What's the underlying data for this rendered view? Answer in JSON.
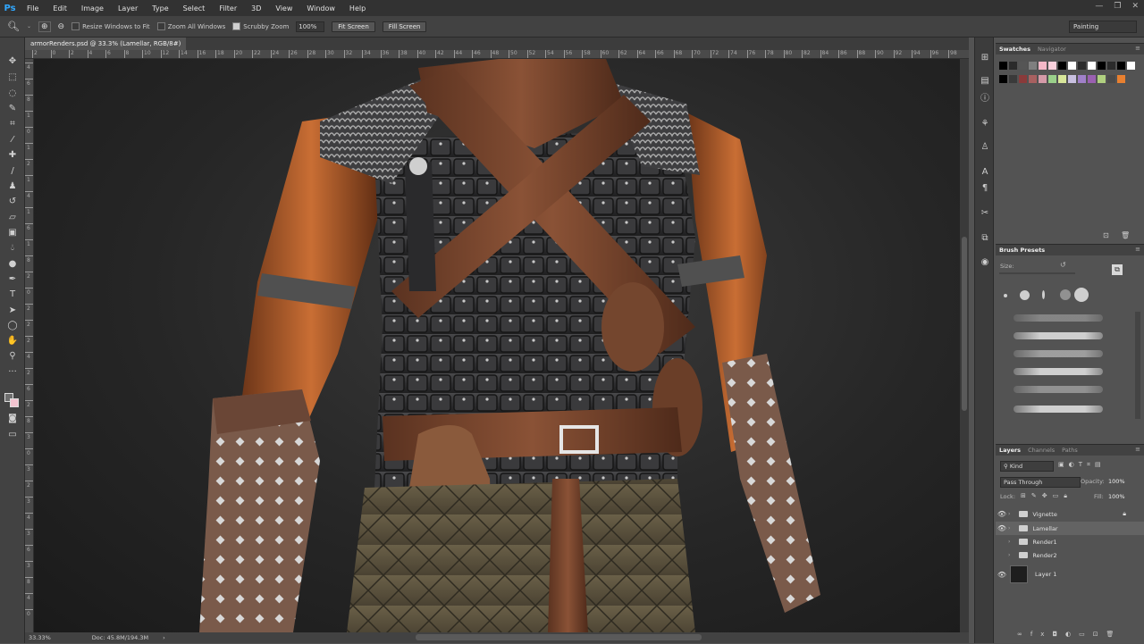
{
  "app": {
    "logo": "Ps",
    "window_controls": [
      "—",
      "❐",
      "✕"
    ]
  },
  "menu": [
    "File",
    "Edit",
    "Image",
    "Layer",
    "Type",
    "Select",
    "Filter",
    "3D",
    "View",
    "Window",
    "Help"
  ],
  "options_bar": {
    "resize_windows": "Resize Windows to Fit",
    "zoom_all": "Zoom All Windows",
    "scrubby_zoom": "Scrubby Zoom",
    "zoom_value": "100%",
    "fit_screen": "Fit Screen",
    "fill_screen": "Fill Screen",
    "workspace": "Painting"
  },
  "document": {
    "tab_title": "armorRenders.psd @ 33.3% (Lamellar, RGB/8#)"
  },
  "ruler": {
    "top_labels": [
      "2",
      "0",
      "2",
      "4",
      "6",
      "8",
      "10",
      "12",
      "14",
      "16",
      "18",
      "20",
      "22",
      "24",
      "26",
      "28",
      "30",
      "32",
      "34",
      "36",
      "38",
      "40",
      "42",
      "44",
      "46",
      "48",
      "50",
      "52",
      "54",
      "56",
      "58",
      "60",
      "62",
      "64",
      "66",
      "68",
      "70",
      "72",
      "74",
      "76",
      "78",
      "80",
      "82",
      "84",
      "86",
      "88",
      "90",
      "92",
      "94",
      "96",
      "98"
    ],
    "left_labels": [
      "4",
      "6",
      "8",
      "1",
      "0",
      "1",
      "2",
      "1",
      "4",
      "1",
      "6",
      "1",
      "8",
      "2",
      "0",
      "2",
      "2",
      "2",
      "4",
      "2",
      "6",
      "2",
      "8",
      "3",
      "0",
      "3",
      "2",
      "3",
      "4",
      "3",
      "6",
      "3",
      "8",
      "4",
      "0"
    ]
  },
  "status": {
    "zoom": "33.33%",
    "doc": "Doc: 45.8M/194.3M"
  },
  "swatches": {
    "tabs": [
      "Swatches",
      "Navigator"
    ],
    "row1": [
      "#000000",
      "#2b2b2b",
      "#555555",
      "#7f7f7f",
      "#f4b8c8",
      "#f9d0dc",
      "#000000",
      "#ffffff",
      "#2b2b2b",
      "#ffffff",
      "#000000",
      "#2b2b2b",
      "#000000",
      "#ffffff"
    ],
    "row2": [
      "#000000",
      "#3a3a3a",
      "#8a3a3a",
      "#a86060",
      "#d59aa8",
      "#9ad08a",
      "#d8e69a",
      "#c8c0e0",
      "#a080c8",
      "#9a60b0",
      "#b0d080",
      "#4a4a4a",
      "#e88030"
    ]
  },
  "brush_presets": {
    "title": "Brush Presets",
    "size_label": "Size:"
  },
  "layers": {
    "tabs": [
      "Layers",
      "Channels",
      "Paths"
    ],
    "kind": "Kind",
    "blend_mode": "Pass Through",
    "opacity_label": "Opacity:",
    "opacity": "100%",
    "lock_label": "Lock:",
    "fill_label": "Fill:",
    "fill": "100%",
    "items": [
      {
        "name": "Vignette",
        "visible": true
      },
      {
        "name": "Lamellar",
        "visible": true
      },
      {
        "name": "Render1",
        "visible": false
      },
      {
        "name": "Render2",
        "visible": false
      },
      {
        "name": "Layer 1",
        "visible": true
      }
    ]
  }
}
